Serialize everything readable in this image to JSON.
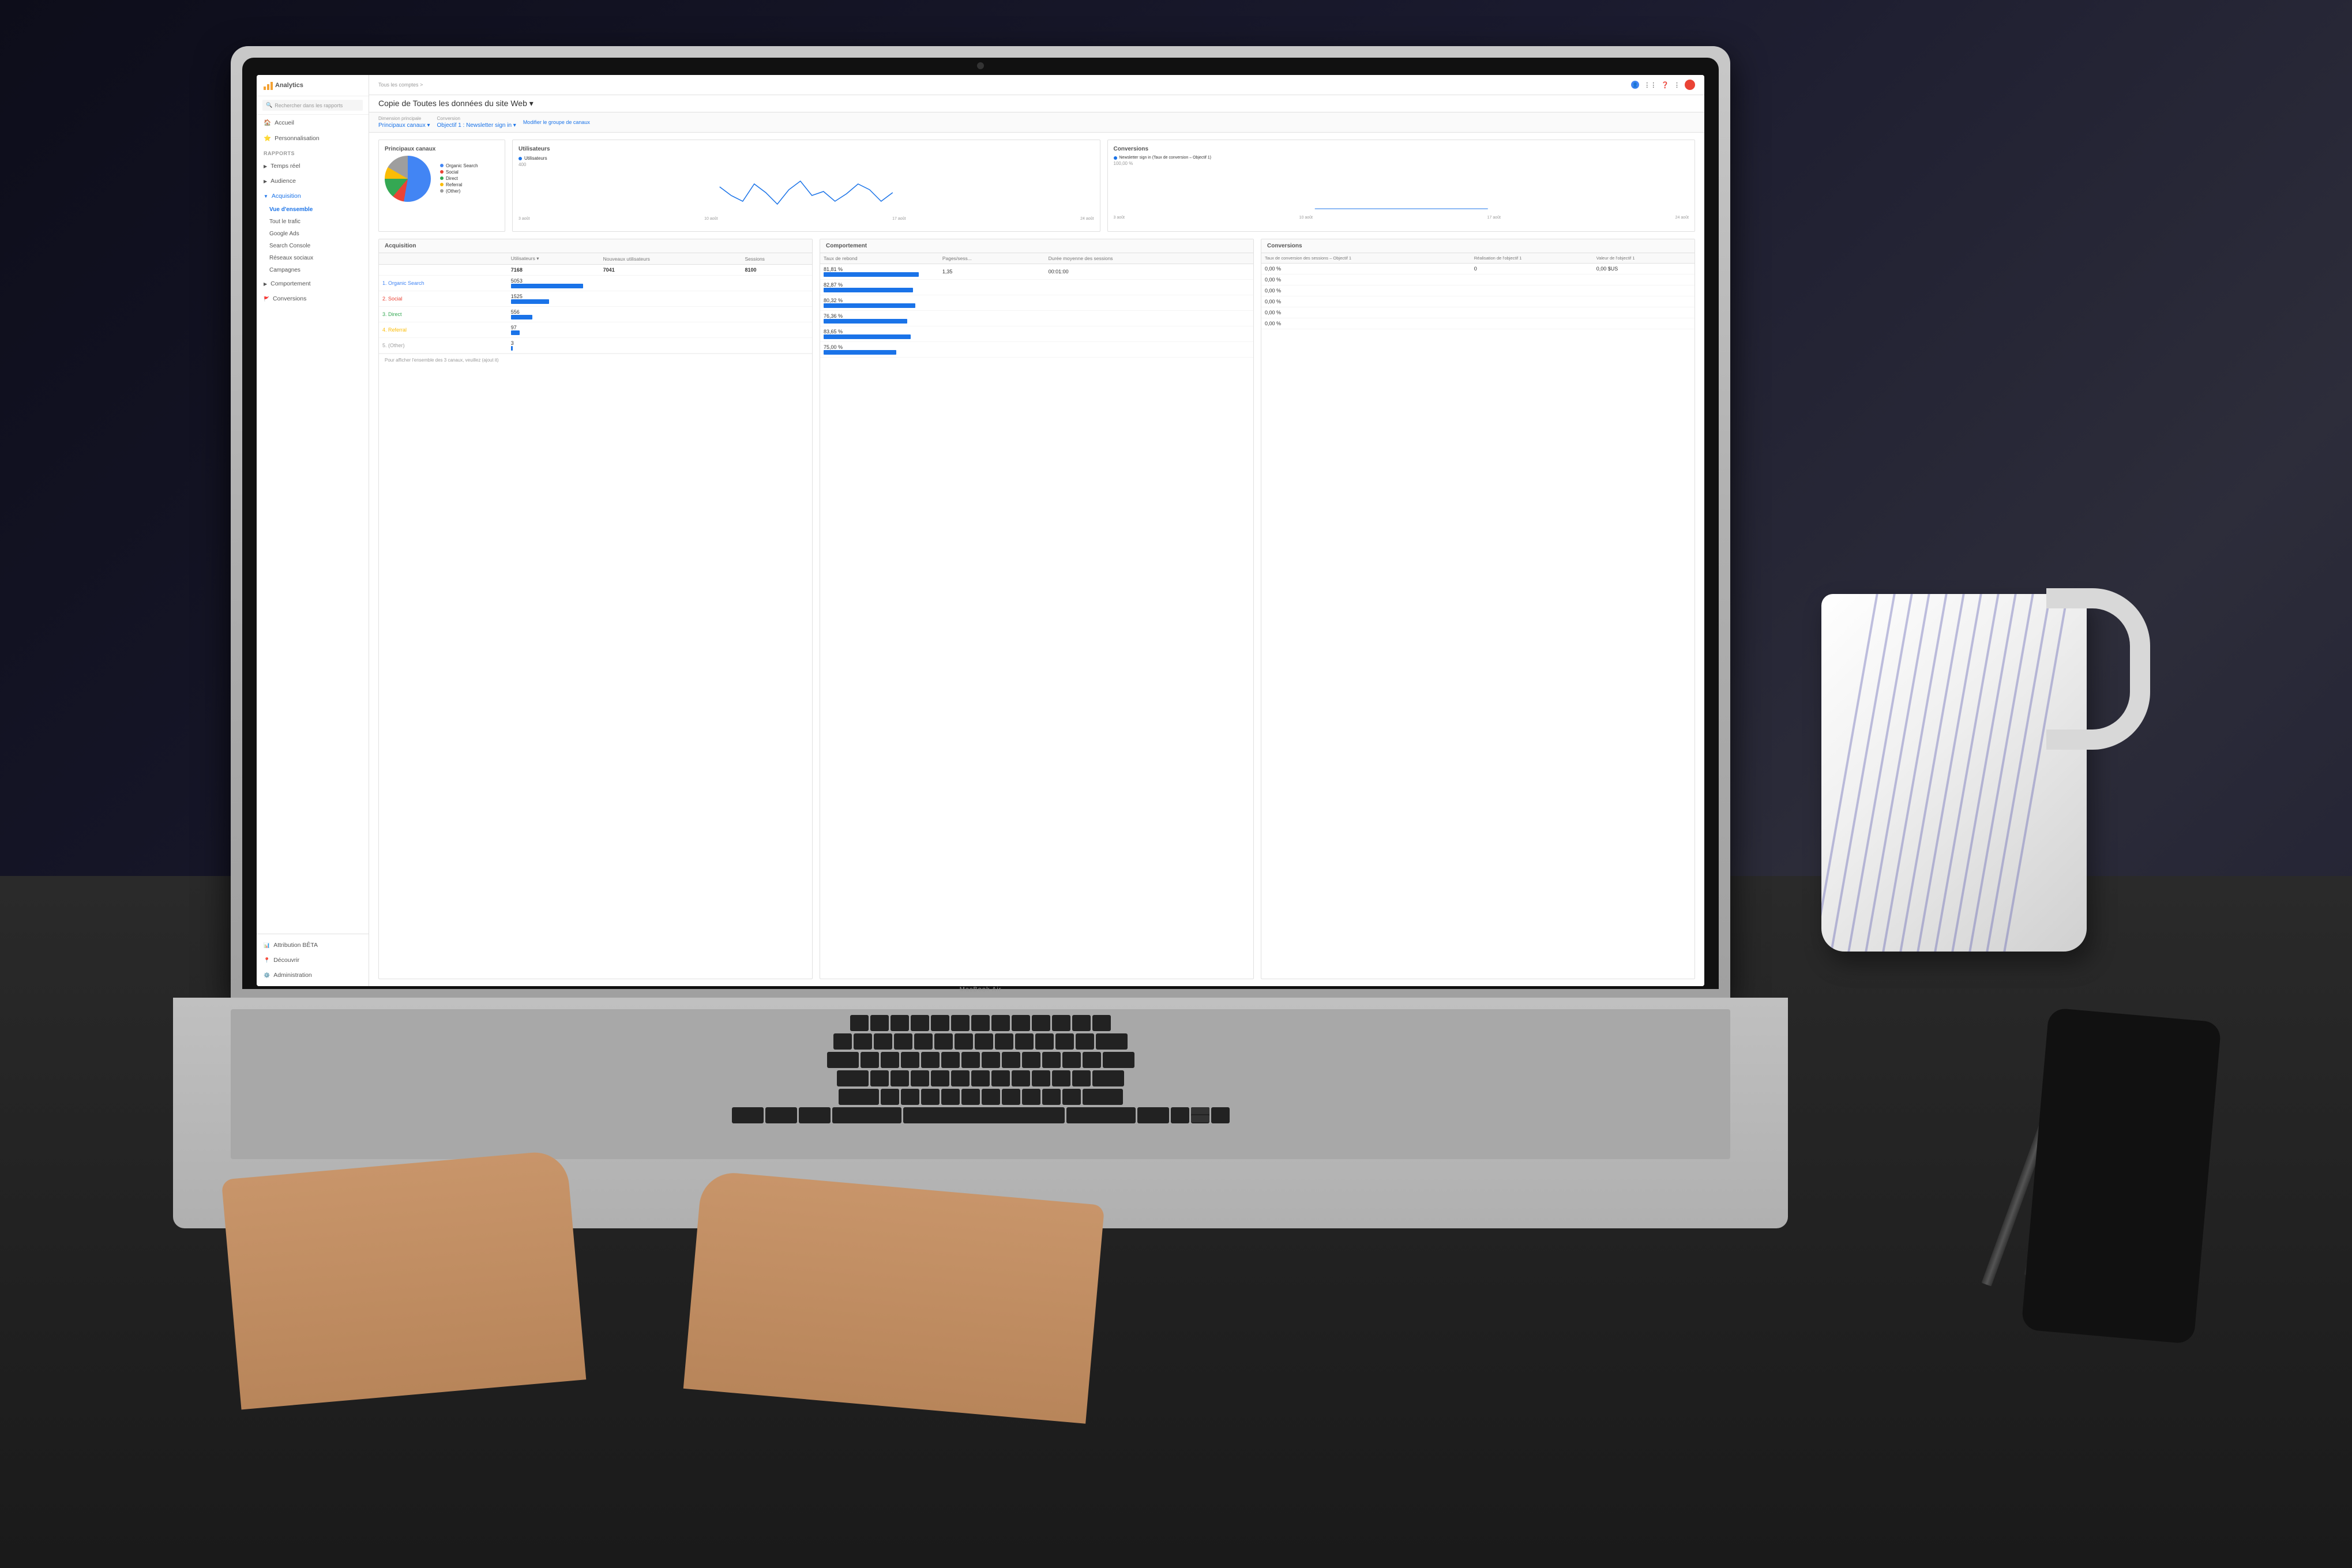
{
  "scene": {
    "bg_color": "#1a1a2e",
    "table_color": "#2a2a2a"
  },
  "laptop": {
    "brand": "MacBook Air",
    "color": "#c0c0c0"
  },
  "analytics": {
    "app_name": "Analytics",
    "breadcrumb": "Tous les comptes >",
    "page_title": "Copie de Toutes les données du site Web ▾",
    "search_placeholder": "Rechercher dans les rapports",
    "filters": {
      "dimension_label": "Dimension principale",
      "dimension_value": "Principaux canaux ▾",
      "conversion_label": "Conversion",
      "conversion_value": "Objectif 1 : Newsletter sign in ▾",
      "modify_link": "Modifier le groupe de canaux"
    },
    "sidebar": {
      "items": [
        {
          "label": "Accueil",
          "icon": "home"
        },
        {
          "label": "Personnalisation",
          "icon": "star"
        }
      ],
      "section_label": "RAPPORTS",
      "reports": [
        {
          "label": "Temps réel",
          "icon": "clock",
          "expanded": false
        },
        {
          "label": "Audience",
          "icon": "person",
          "expanded": false
        },
        {
          "label": "Acquisition",
          "icon": "arrow-up",
          "expanded": true,
          "active": true
        },
        {
          "label": "Comportement",
          "icon": "bar-chart",
          "expanded": false
        },
        {
          "label": "Conversions",
          "icon": "flag",
          "expanded": false
        }
      ],
      "acquisition_sub": [
        {
          "label": "Vue d'ensemble",
          "active": true
        },
        {
          "label": "Tout le trafic"
        },
        {
          "label": "Google Ads"
        },
        {
          "label": "Search Console"
        },
        {
          "label": "Réseaux sociaux"
        },
        {
          "label": "Campagnes"
        }
      ],
      "bottom_items": [
        {
          "label": "Attribution BÊTA"
        },
        {
          "label": "Découvrir"
        },
        {
          "label": "Administration"
        }
      ]
    },
    "charts": {
      "principaux_canaux": {
        "title": "Principaux canaux",
        "legend": [
          {
            "label": "Organic Search",
            "color": "#4285f4"
          },
          {
            "label": "Social",
            "color": "#ea4335"
          },
          {
            "label": "Direct",
            "color": "#34a853"
          },
          {
            "label": "Referral",
            "color": "#fbbc05"
          },
          {
            "label": "(Other)",
            "color": "#9e9e9e"
          }
        ],
        "values": [
          53,
          7,
          14,
          8,
          18
        ]
      },
      "utilisateurs": {
        "title": "Utilisateurs",
        "legend_label": "Utilisateurs",
        "color": "#1a73e8",
        "max_value": 400,
        "min_value": 200,
        "data_points": [
          380,
          320,
          290,
          350,
          310,
          280,
          340,
          360,
          300,
          320,
          290,
          310,
          350,
          330,
          290,
          280,
          310
        ]
      },
      "conversions_chart": {
        "title": "Conversions",
        "legend_label": "Newsletter sign in (Taux de conversion – Objectif 1)",
        "color": "#1a73e8",
        "max_value": "100,00 %",
        "min_value": "0,00 %"
      }
    },
    "acquisition_table": {
      "title": "Acquisition",
      "columns": [
        "Utilisateurs ▾",
        "Nouveaux utilisateurs",
        "Sessions"
      ],
      "total_row": {
        "users": "7168",
        "new_users": "7041",
        "sessions": "8100"
      },
      "rows": [
        {
          "rank": "1",
          "channel": "Organic Search",
          "color": "#4285f4",
          "users": "5053",
          "bar_pct": 85
        },
        {
          "rank": "2",
          "channel": "Social",
          "color": "#ea4335",
          "users": "1525",
          "bar_pct": 45
        },
        {
          "rank": "3",
          "channel": "Direct",
          "color": "#34a853",
          "users": "556",
          "bar_pct": 25
        },
        {
          "rank": "4",
          "channel": "Referral",
          "color": "#fbbc05",
          "users": "97",
          "bar_pct": 10
        },
        {
          "rank": "5",
          "channel": "(Other)",
          "color": "#9e9e9e",
          "users": "3",
          "bar_pct": 2
        }
      ]
    },
    "comportement_table": {
      "title": "Comportement",
      "columns": [
        "Taux de rebond",
        "Pages/sess...",
        "Durée moyenne des sessions"
      ],
      "rows": [
        {
          "bounce": "81,81 %",
          "pages": "1,35",
          "duration": "00:01:00",
          "bar_pct": 85
        },
        {
          "bounce": "82,87 %",
          "pages": "",
          "duration": "",
          "bar_pct": 80
        },
        {
          "bounce": "80,32 %",
          "pages": "",
          "duration": "",
          "bar_pct": 82
        },
        {
          "bounce": "76,36 %",
          "pages": "",
          "duration": "",
          "bar_pct": 75
        },
        {
          "bounce": "83,65 %",
          "pages": "",
          "duration": "",
          "bar_pct": 78
        },
        {
          "bounce": "75,00 %",
          "pages": "",
          "duration": "",
          "bar_pct": 65
        }
      ]
    },
    "conversions_table": {
      "title": "Conversions",
      "columns": [
        "Taux de conversion des sessions – Objectif 1",
        "Réalisation de l'objectif 1",
        "Valeur de l'objectif 1"
      ],
      "rows": [
        {
          "rate": "0,00 %",
          "completion": "0",
          "value": "0,00 $US"
        },
        {
          "rate": "0,00 %",
          "completion": "",
          "value": ""
        },
        {
          "rate": "0,00 %",
          "completion": "",
          "value": ""
        },
        {
          "rate": "0,00 %",
          "completion": "",
          "value": ""
        },
        {
          "rate": "0,00 %",
          "completion": "",
          "value": ""
        },
        {
          "rate": "0,00 %",
          "completion": "",
          "value": ""
        }
      ]
    },
    "footer_note": "Pour afficher l'ensemble des 3 canaux, veuillez (ajout it)"
  }
}
